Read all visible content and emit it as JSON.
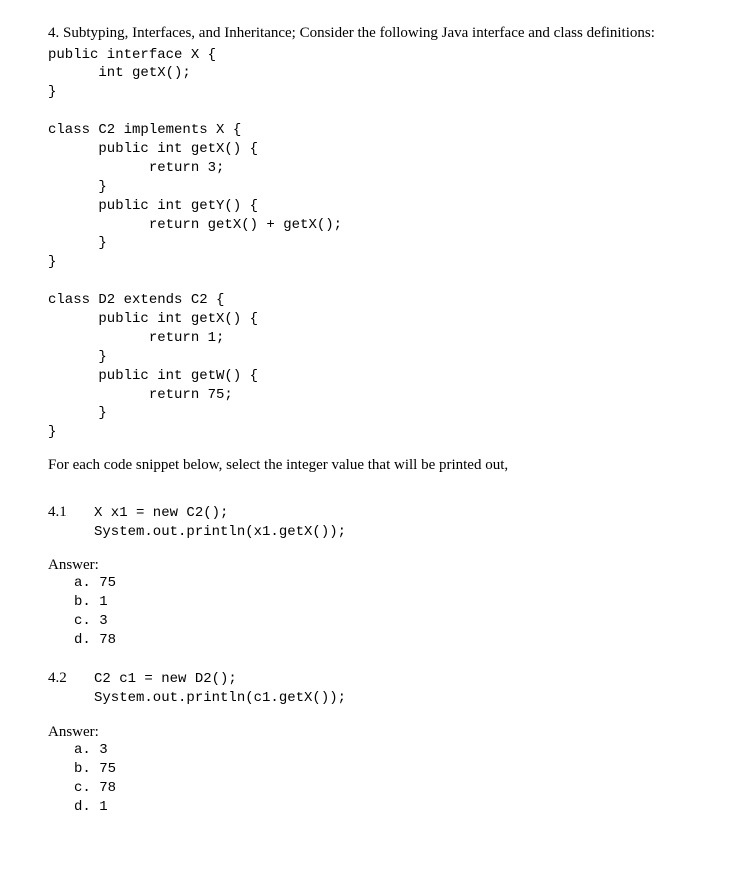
{
  "questionIntro": "4. Subtyping, Interfaces, and Inheritance; Consider the following Java interface and class definitions:",
  "codeBlock": "public interface X {\n      int getX();\n}\n\nclass C2 implements X {\n      public int getX() {\n            return 3;\n      }\n      public int getY() {\n            return getX() + getX();\n      }\n}\n\nclass D2 extends C2 {\n      public int getX() {\n            return 1;\n      }\n      public int getW() {\n            return 75;\n      }\n}",
  "prompt": "For each code snippet below, select the integer value that will be printed out,",
  "subquestions": [
    {
      "number": "4.1",
      "code": "X x1 = new C2();\nSystem.out.println(x1.getX());",
      "answerLabel": "Answer:",
      "options": "a. 75\nb. 1\nc. 3\nd. 78"
    },
    {
      "number": "4.2",
      "code": "C2 c1 = new D2();\nSystem.out.println(c1.getX());",
      "answerLabel": "Answer:",
      "options": "a. 3\nb. 75\nc. 78\nd. 1"
    }
  ]
}
